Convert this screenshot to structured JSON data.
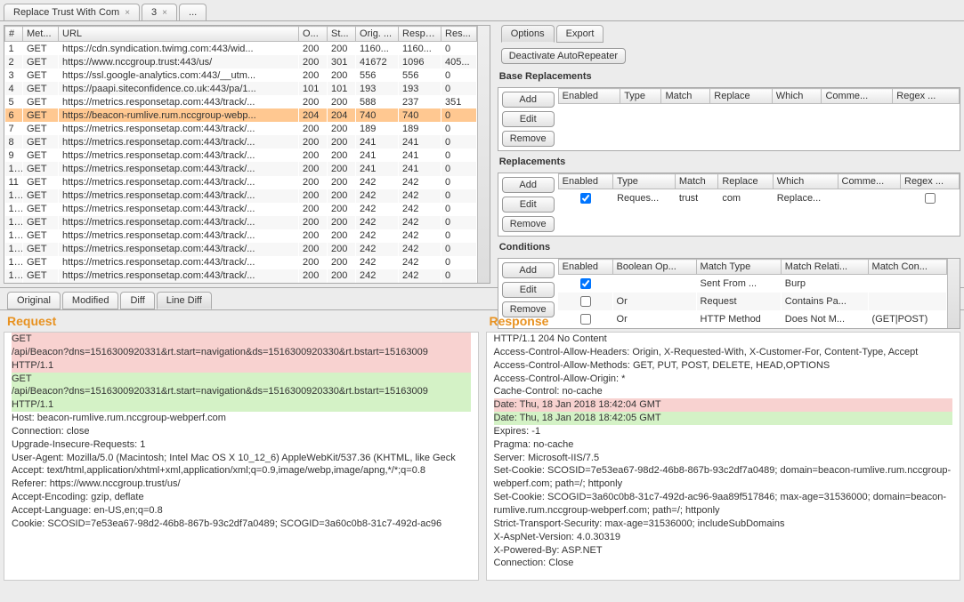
{
  "tabs": {
    "items": [
      {
        "label": "Replace Trust With Com",
        "close": "×"
      },
      {
        "label": "3",
        "close": "×"
      },
      {
        "label": "...",
        "close": ""
      }
    ]
  },
  "topTable": {
    "headers": [
      "#",
      "Met...",
      "URL",
      "O...",
      "St...",
      "Orig. ...",
      "Resp. ...",
      "Res..."
    ],
    "rows": [
      {
        "n": "1",
        "m": "GET",
        "u": "https://cdn.syndication.twimg.com:443/wid...",
        "o": "200",
        "s": "200",
        "ol": "1160...",
        "rl": "1160...",
        "r": "0"
      },
      {
        "n": "2",
        "m": "GET",
        "u": "https://www.nccgroup.trust:443/us/",
        "o": "200",
        "s": "301",
        "ol": "41672",
        "rl": "1096",
        "r": "405..."
      },
      {
        "n": "3",
        "m": "GET",
        "u": "https://ssl.google-analytics.com:443/__utm...",
        "o": "200",
        "s": "200",
        "ol": "556",
        "rl": "556",
        "r": "0"
      },
      {
        "n": "4",
        "m": "GET",
        "u": "https://paapi.siteconfidence.co.uk:443/pa/1...",
        "o": "101",
        "s": "101",
        "ol": "193",
        "rl": "193",
        "r": "0"
      },
      {
        "n": "5",
        "m": "GET",
        "u": "https://metrics.responsetap.com:443/track/...",
        "o": "200",
        "s": "200",
        "ol": "588",
        "rl": "237",
        "r": "351"
      },
      {
        "n": "6",
        "m": "GET",
        "u": "https://beacon-rumlive.rum.nccgroup-webp...",
        "o": "204",
        "s": "204",
        "ol": "740",
        "rl": "740",
        "r": "0",
        "selected": true
      },
      {
        "n": "7",
        "m": "GET",
        "u": "https://metrics.responsetap.com:443/track/...",
        "o": "200",
        "s": "200",
        "ol": "189",
        "rl": "189",
        "r": "0"
      },
      {
        "n": "8",
        "m": "GET",
        "u": "https://metrics.responsetap.com:443/track/...",
        "o": "200",
        "s": "200",
        "ol": "241",
        "rl": "241",
        "r": "0"
      },
      {
        "n": "9",
        "m": "GET",
        "u": "https://metrics.responsetap.com:443/track/...",
        "o": "200",
        "s": "200",
        "ol": "241",
        "rl": "241",
        "r": "0"
      },
      {
        "n": "10",
        "m": "GET",
        "u": "https://metrics.responsetap.com:443/track/...",
        "o": "200",
        "s": "200",
        "ol": "241",
        "rl": "241",
        "r": "0"
      },
      {
        "n": "11",
        "m": "GET",
        "u": "https://metrics.responsetap.com:443/track/...",
        "o": "200",
        "s": "200",
        "ol": "242",
        "rl": "242",
        "r": "0"
      },
      {
        "n": "12",
        "m": "GET",
        "u": "https://metrics.responsetap.com:443/track/...",
        "o": "200",
        "s": "200",
        "ol": "242",
        "rl": "242",
        "r": "0"
      },
      {
        "n": "13",
        "m": "GET",
        "u": "https://metrics.responsetap.com:443/track/...",
        "o": "200",
        "s": "200",
        "ol": "242",
        "rl": "242",
        "r": "0"
      },
      {
        "n": "14",
        "m": "GET",
        "u": "https://metrics.responsetap.com:443/track/...",
        "o": "200",
        "s": "200",
        "ol": "242",
        "rl": "242",
        "r": "0"
      },
      {
        "n": "15",
        "m": "GET",
        "u": "https://metrics.responsetap.com:443/track/...",
        "o": "200",
        "s": "200",
        "ol": "242",
        "rl": "242",
        "r": "0"
      },
      {
        "n": "16",
        "m": "GET",
        "u": "https://metrics.responsetap.com:443/track/...",
        "o": "200",
        "s": "200",
        "ol": "242",
        "rl": "242",
        "r": "0"
      },
      {
        "n": "17",
        "m": "GET",
        "u": "https://metrics.responsetap.com:443/track/...",
        "o": "200",
        "s": "200",
        "ol": "242",
        "rl": "242",
        "r": "0"
      },
      {
        "n": "18",
        "m": "GET",
        "u": "https://metrics.responsetap.com:443/track/...",
        "o": "200",
        "s": "200",
        "ol": "242",
        "rl": "242",
        "r": "0"
      }
    ]
  },
  "rightTabs": [
    "Options",
    "Export"
  ],
  "deactivate": "Deactivate AutoRepeater",
  "sections": {
    "base": {
      "title": "Base Replacements",
      "headers": [
        "Enabled",
        "Type",
        "Match",
        "Replace",
        "Which",
        "Comme...",
        "Regex ..."
      ]
    },
    "repl": {
      "title": "Replacements",
      "headers": [
        "Enabled",
        "Type",
        "Match",
        "Replace",
        "Which",
        "Comme...",
        "Regex ..."
      ],
      "rows": [
        {
          "enabled": true,
          "type": "Reques...",
          "match": "trust",
          "replace": "com",
          "which": "Replace...",
          "comment": "",
          "regex": false
        }
      ]
    },
    "cond": {
      "title": "Conditions",
      "headers": [
        "Enabled",
        "Boolean Op...",
        "Match Type",
        "Match Relati...",
        "Match Con..."
      ],
      "rows": [
        {
          "enabled": true,
          "bool": "",
          "type": "Sent From ...",
          "rel": "Burp",
          "con": ""
        },
        {
          "enabled": false,
          "bool": "Or",
          "type": "Request",
          "rel": "Contains Pa...",
          "con": ""
        },
        {
          "enabled": false,
          "bool": "Or",
          "type": "HTTP Method",
          "rel": "Does Not M...",
          "con": "(GET|POST)"
        }
      ]
    }
  },
  "sideButtons": {
    "add": "Add",
    "edit": "Edit",
    "remove": "Remove"
  },
  "detailTabs": [
    "Original",
    "Modified",
    "Diff",
    "Line Diff"
  ],
  "request": {
    "title": "Request",
    "lines": [
      {
        "t": "GET",
        "cls": "hl-red"
      },
      {
        "t": "/api/Beacon?dns=1516300920331&rt.start=navigation&ds=1516300920330&rt.bstart=15163009",
        "cls": "hl-red"
      },
      {
        "t": "HTTP/1.1",
        "cls": "hl-red"
      },
      {
        "t": "GET",
        "cls": "hl-green"
      },
      {
        "t": "/api/Beacon?dns=1516300920331&rt.start=navigation&ds=1516300920330&rt.bstart=15163009",
        "cls": "hl-green"
      },
      {
        "t": "HTTP/1.1",
        "cls": "hl-green"
      },
      {
        "t": "Host: beacon-rumlive.rum.nccgroup-webperf.com"
      },
      {
        "t": "Connection: close"
      },
      {
        "t": "Upgrade-Insecure-Requests: 1"
      },
      {
        "t": "User-Agent: Mozilla/5.0 (Macintosh; Intel Mac OS X 10_12_6) AppleWebKit/537.36 (KHTML, like Geck"
      },
      {
        "t": "Accept: text/html,application/xhtml+xml,application/xml;q=0.9,image/webp,image/apng,*/*;q=0.8"
      },
      {
        "t": "Referer: https://www.nccgroup.trust/us/"
      },
      {
        "t": "Accept-Encoding: gzip, deflate"
      },
      {
        "t": "Accept-Language: en-US,en;q=0.8"
      },
      {
        "t": "Cookie: SCOSID=7e53ea67-98d2-46b8-867b-93c2df7a0489; SCOGID=3a60c0b8-31c7-492d-ac96"
      }
    ]
  },
  "response": {
    "title": "Response",
    "lines": [
      {
        "t": "HTTP/1.1 204 No Content"
      },
      {
        "t": "Access-Control-Allow-Headers: Origin, X-Requested-With, X-Customer-For, Content-Type, Accept"
      },
      {
        "t": "Access-Control-Allow-Methods: GET, PUT, POST, DELETE, HEAD,OPTIONS"
      },
      {
        "t": "Access-Control-Allow-Origin: *"
      },
      {
        "t": "Cache-Control: no-cache"
      },
      {
        "t": "Date: Thu, 18 Jan 2018 18:42:04 GMT",
        "cls": "hl-red"
      },
      {
        "t": "Date: Thu, 18 Jan 2018 18:42:05 GMT",
        "cls": "hl-green"
      },
      {
        "t": "Expires: -1"
      },
      {
        "t": "Pragma: no-cache"
      },
      {
        "t": "Server: Microsoft-IIS/7.5"
      },
      {
        "t": "Set-Cookie: SCOSID=7e53ea67-98d2-46b8-867b-93c2df7a0489; domain=beacon-rumlive.rum.nccgroup-webperf.com; path=/; httponly"
      },
      {
        "t": "Set-Cookie: SCOGID=3a60c0b8-31c7-492d-ac96-9aa89f517846; max-age=31536000; domain=beacon-rumlive.rum.nccgroup-webperf.com; path=/; httponly"
      },
      {
        "t": "Strict-Transport-Security: max-age=31536000; includeSubDomains"
      },
      {
        "t": "X-AspNet-Version: 4.0.30319"
      },
      {
        "t": "X-Powered-By: ASP.NET"
      },
      {
        "t": "Connection: Close"
      }
    ]
  }
}
